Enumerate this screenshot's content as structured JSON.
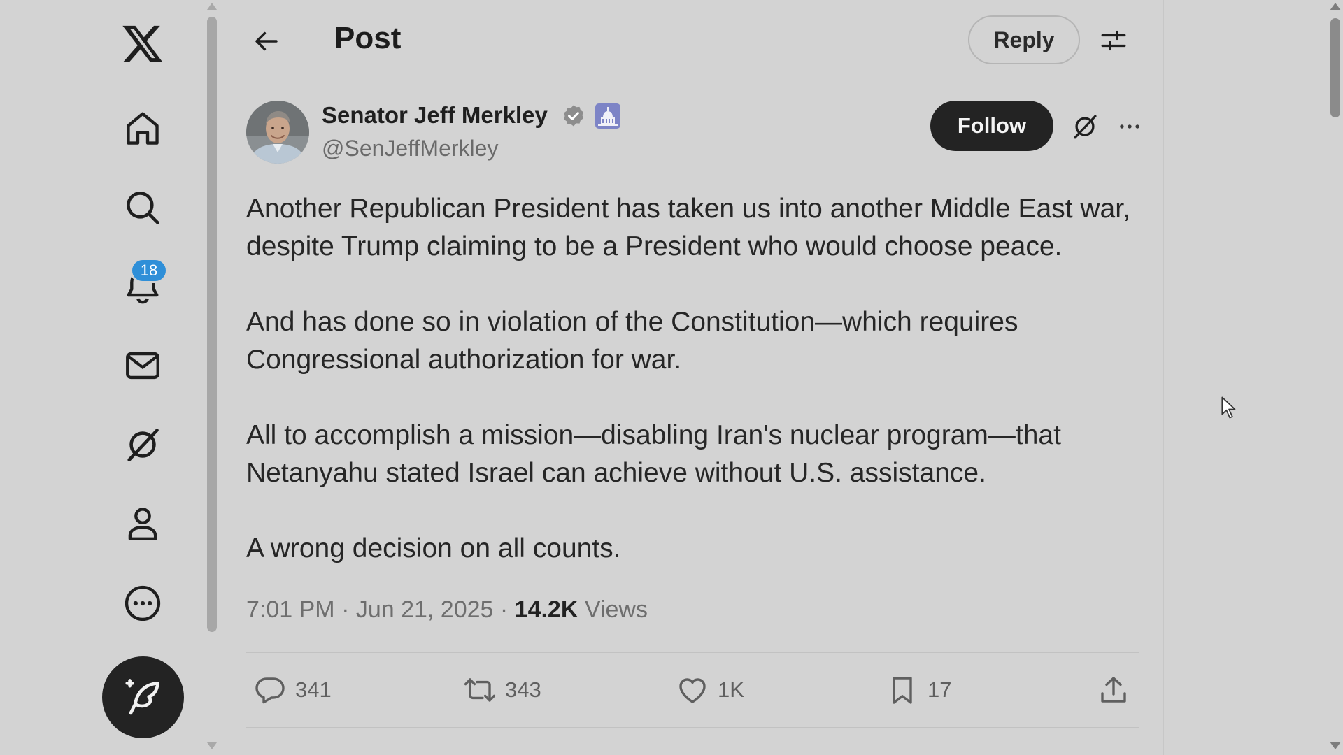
{
  "nav": {
    "logo_icon": "x-logo-icon",
    "items": [
      {
        "id": "home",
        "icon": "home-icon"
      },
      {
        "id": "explore",
        "icon": "search-icon"
      },
      {
        "id": "notifications",
        "icon": "bell-icon",
        "badge": "18"
      },
      {
        "id": "messages",
        "icon": "mail-icon"
      },
      {
        "id": "grok",
        "icon": "grok-icon"
      },
      {
        "id": "profile",
        "icon": "person-icon"
      },
      {
        "id": "more",
        "icon": "more-circle-icon"
      }
    ],
    "compose_icon": "compose-feather-icon"
  },
  "header": {
    "title": "Post",
    "reply_label": "Reply"
  },
  "post": {
    "author_name": "Senator Jeff Merkley",
    "author_handle": "@SenJeffMerkley",
    "verified_icon": "verified-badge-icon",
    "affiliation_icon": "capitol-affiliation-icon",
    "follow_label": "Follow",
    "paragraphs": [
      "Another Republican President has taken us into another Middle East war, despite Trump claiming to be a President who would choose peace.",
      "And has done so in violation of the Constitution—which requires Congressional authorization for war.",
      "All to accomplish a mission—disabling Iran's nuclear program—that Netanyahu stated Israel can achieve without U.S. assistance.",
      "A wrong decision on all counts."
    ],
    "timestamp": "7:01 PM · Jun 21, 2025 · ",
    "views_count": "14.2K",
    "views_label": "Views",
    "stats": {
      "replies": "341",
      "reposts": "343",
      "likes": "1K",
      "bookmarks": "17"
    }
  },
  "colors": {
    "background": "#d3d3d3",
    "follow_button": "#232323",
    "badge": "#2f8fd8",
    "verified": "#8d8d8d"
  }
}
